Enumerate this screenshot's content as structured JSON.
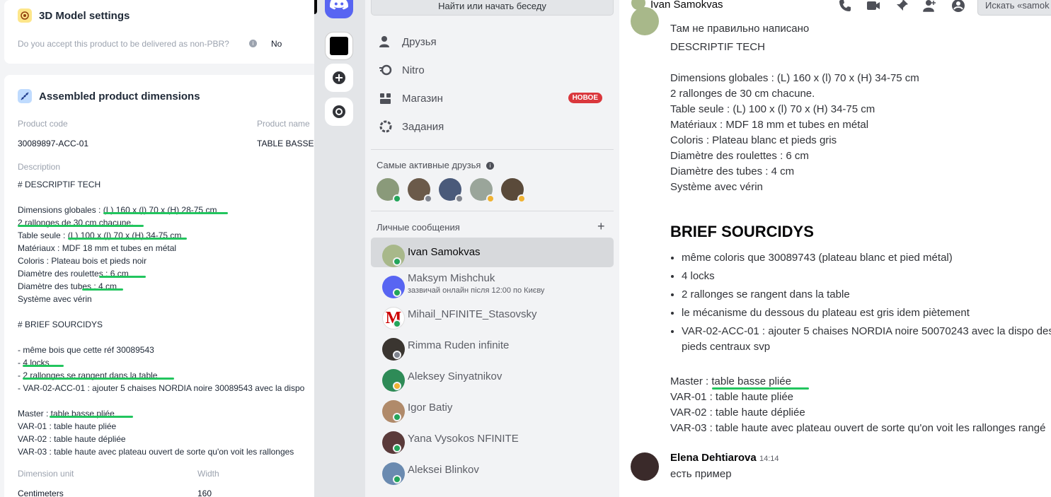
{
  "left_page": {
    "model_section": {
      "title": "3D Model settings",
      "question": "Do you accept this product to be delivered as non-PBR?",
      "answer": "No"
    },
    "dimensions_section": {
      "title": "Assembled product dimensions",
      "product_code_label": "Product code",
      "product_code": "30089897-ACC-01",
      "product_name_label": "Product name",
      "product_name": "TABLE BASSE -",
      "description_label": "Description",
      "description_lines": [
        "# DESCRIPTIF TECH",
        "",
        "Dimensions globales : (L) 160 x (l) 70 x (H) 28-75 cm",
        "2 rallonges de 30 cm chacune.",
        "Table seule : (L) 100 x (l) 70 x (H) 34-75 cm",
        "Matériaux : MDF 18 mm et tubes en métal",
        "Coloris : Plateau bois et pieds noir",
        "Diamètre des roulettes : 6 cm",
        "Diamètre des tubes : 4 cm",
        "Système avec vérin",
        "",
        "# BRIEF SOURCIDYS",
        "",
        "- même bois que cette réf 30089543",
        "- 4 locks",
        "- 2 rallonges se rangent dans la table",
        "- VAR-02-ACC-01 : ajouter 5 chaises NORDIA noire 30089543 avec la dispo",
        "",
        "Master : table basse pliée",
        "VAR-01 : table haute pliée",
        "VAR-02 : table haute dépliée",
        "VAR-03 : table haute avec plateau ouvert de sorte qu'on voit les rallonges"
      ],
      "dimension_unit_label": "Dimension unit",
      "dimension_unit": "Centimeters",
      "width_label": "Width",
      "width": "160"
    }
  },
  "discord": {
    "search_placeholder": "Найти или начать беседу",
    "nav": [
      {
        "label": "Друзья",
        "icon": "friends-icon"
      },
      {
        "label": "Nitro",
        "icon": "nitro-icon"
      },
      {
        "label": "Магазин",
        "icon": "shop-icon",
        "badge": "НОВОЕ"
      },
      {
        "label": "Задания",
        "icon": "quests-icon"
      }
    ],
    "active_friends_label": "Самые активные друзья",
    "dm_label": "Личные сообщения",
    "dms": [
      {
        "name": "Ivan Samokvas",
        "sub": "",
        "status": "online"
      },
      {
        "name": "Maksym Mishchuk",
        "sub": "зазвичай онлайн після 12:00 по Києву",
        "status": "online"
      },
      {
        "name": "Mihail_NFINITE_Stasovsky",
        "sub": "",
        "status": "online"
      },
      {
        "name": "Rimma Ruden infinite",
        "sub": "",
        "status": "offline"
      },
      {
        "name": "Aleksey Sinyatnikov",
        "sub": "",
        "status": "idle"
      },
      {
        "name": "Igor Batiy",
        "sub": "",
        "status": "online"
      },
      {
        "name": "Yana Vysokos NFINITE",
        "sub": "",
        "status": "online"
      },
      {
        "name": "Aleksei Blinkov",
        "sub": "",
        "status": "online"
      }
    ],
    "chat": {
      "title": "Ivan Samokvas",
      "search_placeholder": "Искать «samok",
      "msg_intro": "Там не правильно написано",
      "msg_block1": "DESCRIPTIF TECH\n\nDimensions globales : (L) 160 x (l) 70 x (H) 34-75 cm\n2 rallonges de 30 cm chacune.\nTable seule : (L) 100 x (l) 70 x (H) 34-75 cm\nMatériaux : MDF 18 mm et tubes en métal\nColoris : Plateau blanc et pieds gris\nDiamètre des roulettes : 6 cm\nDiamètre des tubes : 4 cm\nSystème avec vérin",
      "brief_title": "BRIEF SOURCIDYS",
      "brief_items": [
        "même coloris que 30089743 (plateau blanc et pied métal)",
        "4 locks",
        "2 rallonges se rangent dans la table",
        "le mécanisme du dessous du plateau est gris idem piètement",
        "VAR-02-ACC-01 : ajouter 5 chaises NORDIA noire 50070243 avec la dispo des pieds centraux svp"
      ],
      "variants": "Master : table basse pliée\nVAR-01 : table haute pliée\nVAR-02 : table haute dépliée\nVAR-03 : table haute avec plateau ouvert de sorte qu'on voit les rallonges rangé",
      "reply_author": "Elena Dehtiarova",
      "reply_time": "14:14",
      "reply_text": "есть пример"
    }
  },
  "colors": {
    "discord_blurple": "#5865f2",
    "online": "#23a55a",
    "idle": "#f0b232",
    "offline": "#80848e",
    "highlight": "#22c55e"
  }
}
